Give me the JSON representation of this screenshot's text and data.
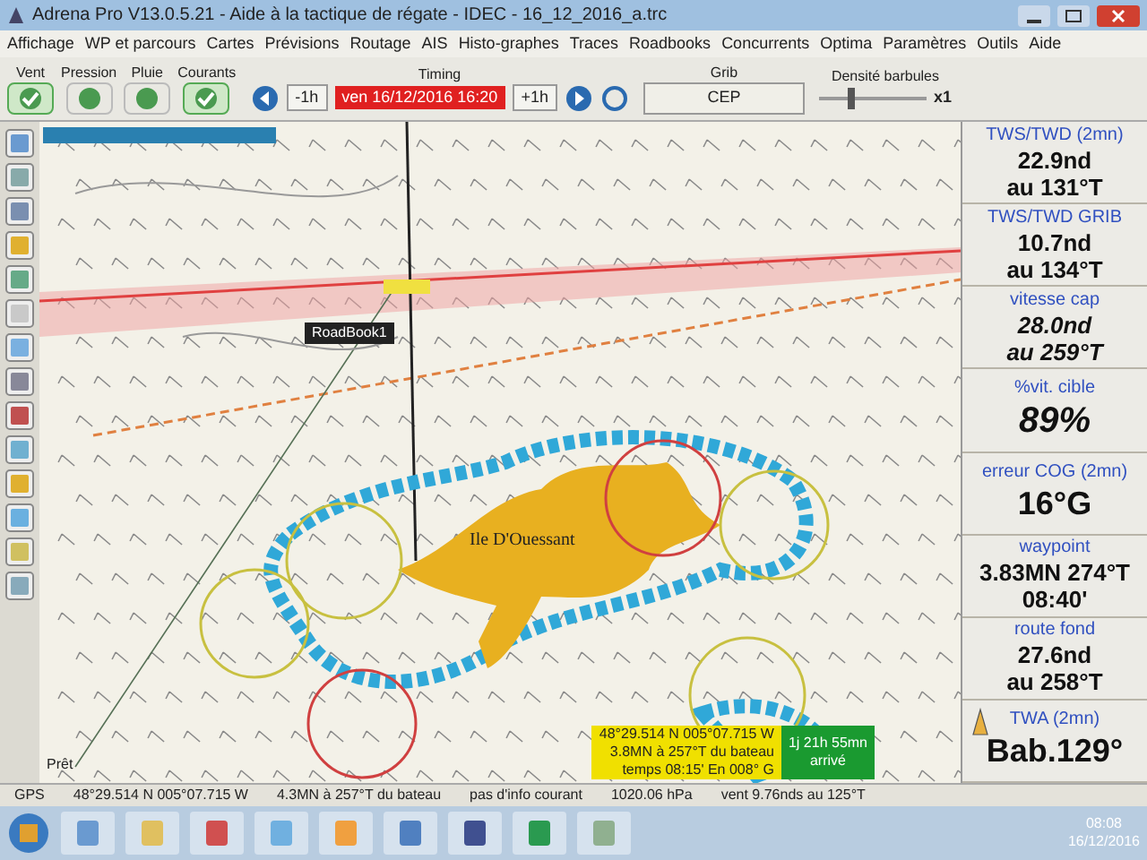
{
  "window": {
    "title": "Adrena Pro V13.0.5.21 - Aide à la tactique de régate - IDEC - 16_12_2016_a.trc"
  },
  "menu": [
    "Affichage",
    "WP et parcours",
    "Cartes",
    "Prévisions",
    "Routage",
    "AIS",
    "Histo-graphes",
    "Traces",
    "Roadbooks",
    "Concurrents",
    "Optima",
    "Paramètres",
    "Outils",
    "Aide"
  ],
  "toolbar": {
    "layers": [
      {
        "label": "Vent",
        "checked": true
      },
      {
        "label": "Pression",
        "checked": false
      },
      {
        "label": "Pluie",
        "checked": false
      },
      {
        "label": "Courants",
        "checked": true
      }
    ],
    "timing": {
      "title": "Timing",
      "back": "-1h",
      "date": "ven 16/12/2016 16:20",
      "forward": "+1h"
    },
    "grib": {
      "title": "Grib",
      "model": "CEP"
    },
    "density": {
      "title": "Densité barbules",
      "value": "x1",
      "level": 0.3
    }
  },
  "map": {
    "roadbook": "RoadBook1",
    "island": "Ile D'Ouessant",
    "status": "Prêt",
    "position_box": [
      "48°29.514 N 005°07.715 W",
      "3.8MN à 257°T du bateau",
      "temps 08:15' En 008° G"
    ],
    "eta_box": [
      "1j 21h 55mn",
      "arrivé"
    ]
  },
  "panel": [
    {
      "label": "TWS/TWD (2mn)",
      "lines": [
        "22.9nd",
        "au 131°T"
      ],
      "kind": "normal"
    },
    {
      "label": "TWS/TWD GRIB",
      "lines": [
        "10.7nd",
        "au 134°T"
      ],
      "kind": "normal"
    },
    {
      "label": "vitesse cap",
      "lines": [
        "28.0nd",
        "au 259°T"
      ],
      "kind": "italic"
    },
    {
      "label": "%vit. cible",
      "lines": [
        "89%"
      ],
      "kind": "big-italic"
    },
    {
      "label": "erreur COG (2mn)",
      "lines": [
        "16°G"
      ],
      "kind": "big"
    },
    {
      "label": "waypoint",
      "lines": [
        "3.83MN 274°T",
        "08:40'"
      ],
      "kind": "normal"
    },
    {
      "label": "route fond",
      "lines": [
        "27.6nd",
        "au 258°T"
      ],
      "kind": "normal"
    },
    {
      "label": "TWA (2mn)",
      "lines": [
        "Bab.129°"
      ],
      "kind": "boat"
    }
  ],
  "status_bar": [
    "GPS",
    "48°29.514 N 005°07.715 W",
    "4.3MN à 257°T du bateau",
    "pas d'info courant",
    "1020.06 hPa",
    "vent 9.76nds au 125°T"
  ],
  "taskbar": {
    "time": "08:08",
    "date": "16/12/2016"
  }
}
